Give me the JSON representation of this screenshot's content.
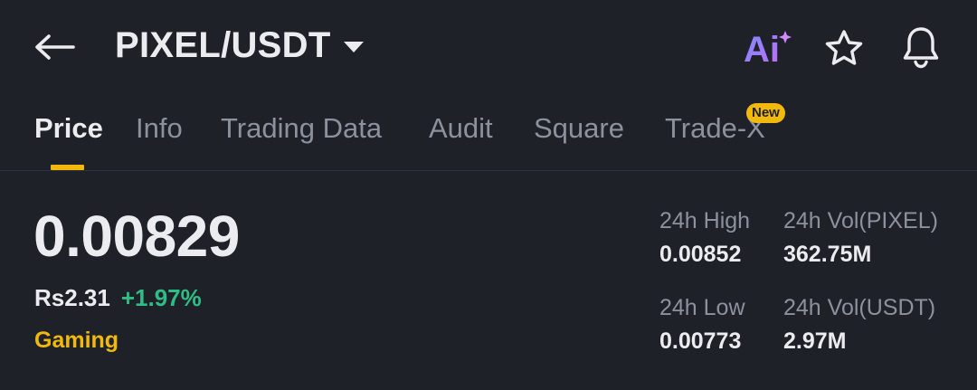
{
  "header": {
    "back_icon": "arrow-left-icon",
    "pair": "PIXEL/USDT",
    "ai_label": "Ai",
    "star_icon": "star-icon",
    "bell_icon": "bell-icon"
  },
  "tabs": [
    {
      "label": "Price",
      "active": true
    },
    {
      "label": "Info",
      "active": false
    },
    {
      "label": "Trading Data",
      "active": false
    },
    {
      "label": "Audit",
      "active": false
    },
    {
      "label": "Square",
      "active": false
    },
    {
      "label": "Trade-X",
      "active": false,
      "badge": "New"
    }
  ],
  "market": {
    "price": "0.00829",
    "fiat_price": "Rs2.31",
    "change": "+1.97%",
    "tag": "Gaming"
  },
  "stats": {
    "high_label": "24h High",
    "high_value": "0.00852",
    "vol_base_label": "24h Vol(PIXEL)",
    "vol_base_value": "362.75M",
    "low_label": "24h Low",
    "low_value": "0.00773",
    "vol_quote_label": "24h Vol(USDT)",
    "vol_quote_value": "2.97M"
  },
  "colors": {
    "background": "#1f2129",
    "accent": "#f0b90b",
    "positive": "#2ebd85",
    "text_primary": "#eaecef",
    "text_secondary": "#8b929e"
  }
}
